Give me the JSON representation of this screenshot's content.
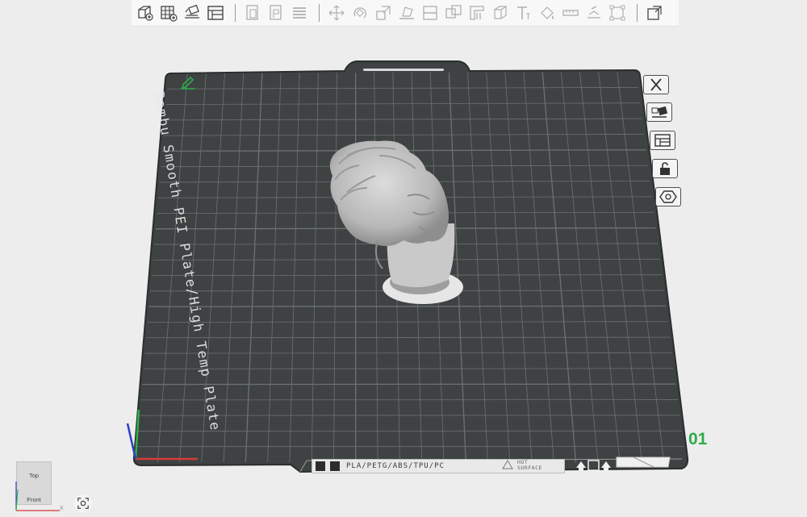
{
  "toolbar": {
    "left_group": [
      "add-cube-icon",
      "arrange-grid-icon",
      "auto-orient-icon",
      "plate-layout-icon"
    ],
    "mid_group": [
      "copy-plate-icon",
      "paste-plate-icon",
      "layers-icon"
    ],
    "tools": [
      "move-icon",
      "rotate-icon",
      "scale-icon",
      "lay-on-face-icon",
      "cut-icon",
      "boolean-icon",
      "support-paint-icon",
      "seam-paint-icon",
      "text-icon",
      "color-paint-icon",
      "measure-icon",
      "assembly-icon",
      "bounding-box-icon"
    ],
    "right_group": [
      "assembly-view-icon"
    ]
  },
  "plate": {
    "label": "Bambu Smooth PEI Plate/High Temp Plate",
    "number": "01",
    "filaments": "PLA/PETG/ABS/TPU/PC",
    "hot_surface_line1": "HOT",
    "hot_surface_line2": "SURFACE"
  },
  "side_buttons": [
    "close-plate-icon",
    "auto-arrange-icon",
    "plate-settings-icon",
    "lock-plate-icon",
    "orient-plate-icon"
  ],
  "view_cube": {
    "top_label": "Top",
    "front_label": "Front",
    "axis_x": "X"
  },
  "colors": {
    "plate": "#3e4243",
    "grid": "#6c7172",
    "number": "#2dad4a",
    "model": "#c8c8c8"
  }
}
